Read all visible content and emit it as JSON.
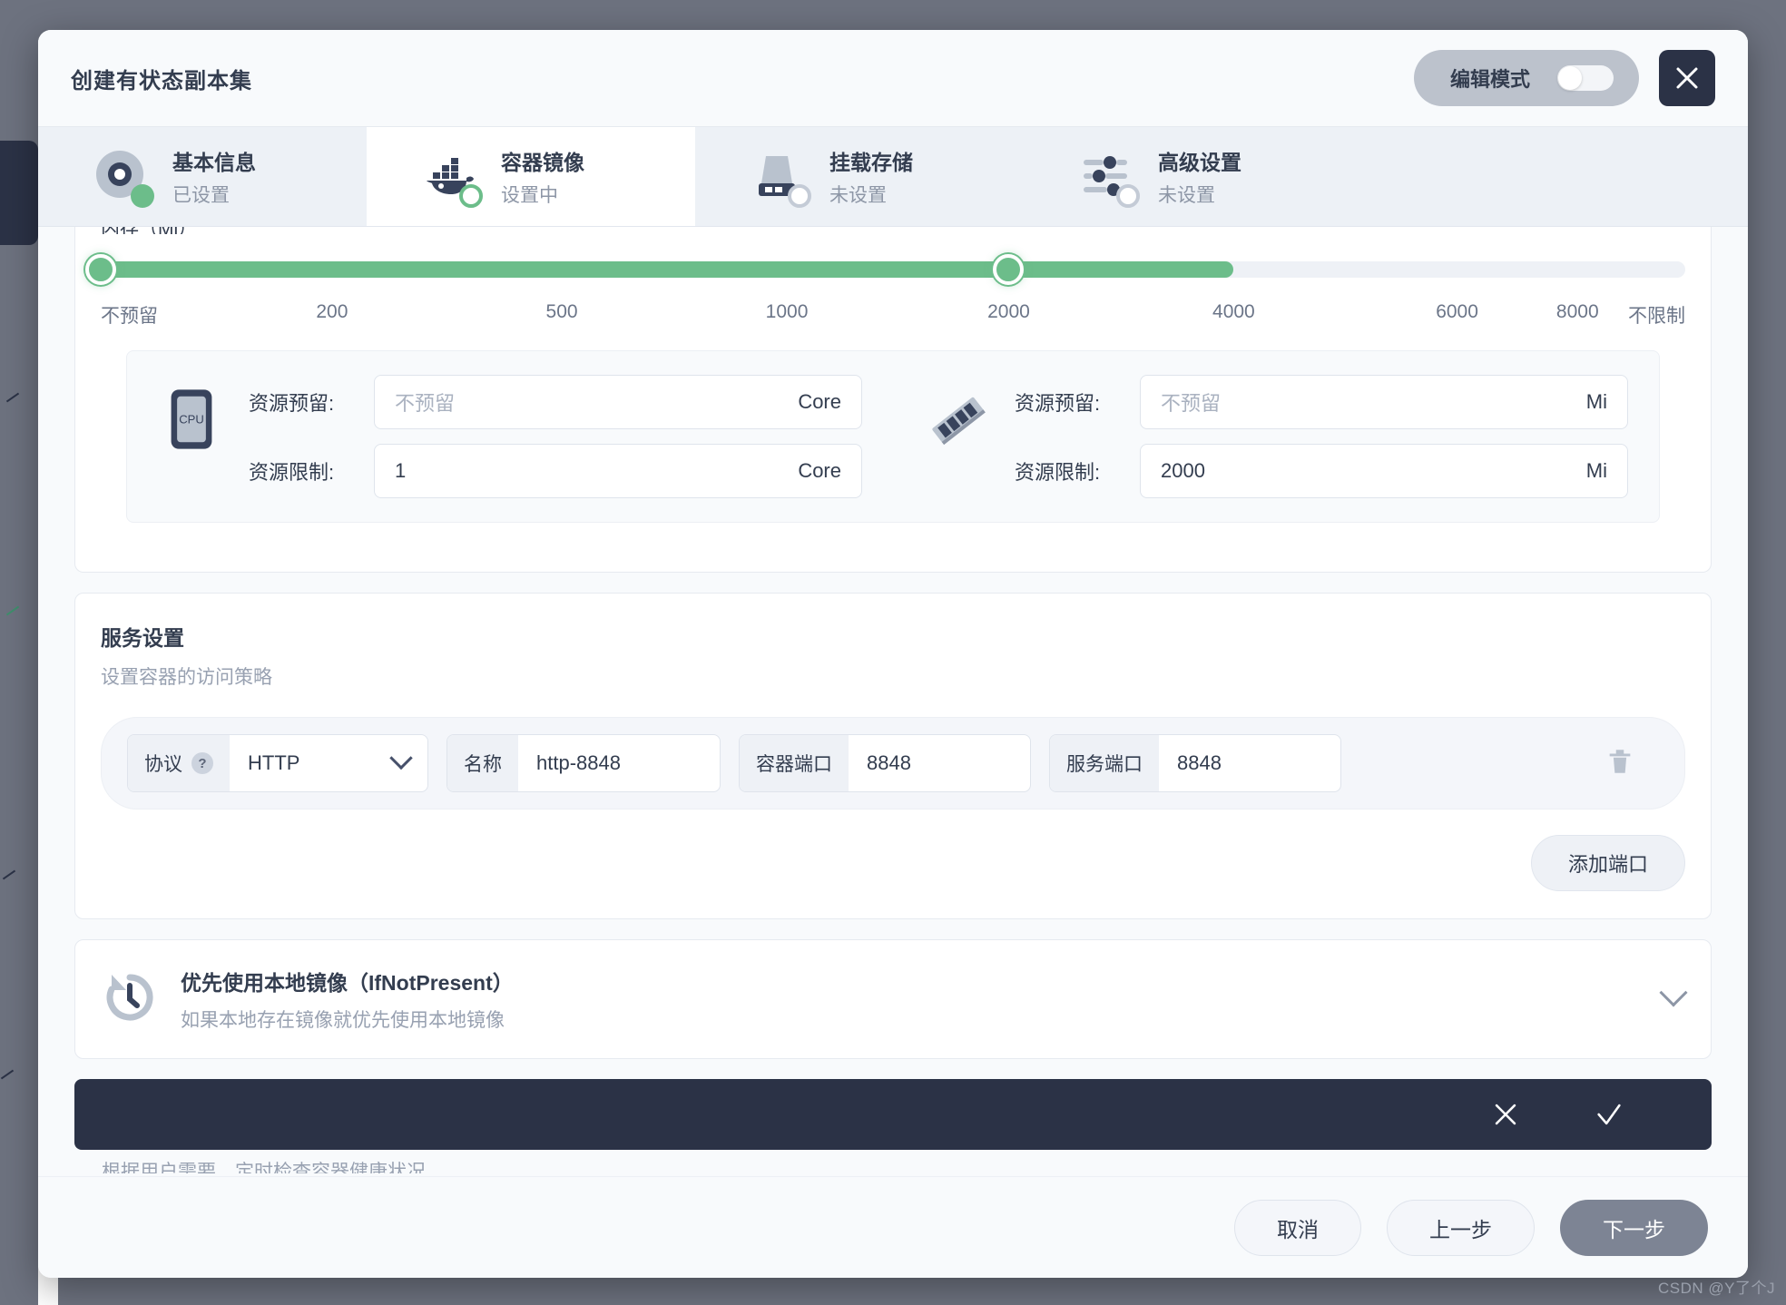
{
  "header": {
    "title": "创建有状态副本集",
    "edit_mode_label": "编辑模式",
    "edit_mode_on": false,
    "close_icon": "close-icon"
  },
  "tabs": [
    {
      "label": "基本信息",
      "status": "已设置",
      "icon": "disc-icon",
      "state": "done",
      "active": false
    },
    {
      "label": "容器镜像",
      "status": "设置中",
      "icon": "docker-icon",
      "state": "current",
      "active": true
    },
    {
      "label": "挂载存储",
      "status": "未设置",
      "icon": "storage-icon",
      "state": "todo",
      "active": false
    },
    {
      "label": "高级设置",
      "status": "未设置",
      "icon": "sliders-icon",
      "state": "todo",
      "active": false
    }
  ],
  "memory_slider": {
    "label": "内存（Mi）",
    "ticks": [
      "不预留",
      "200",
      "500",
      "1000",
      "2000",
      "4000",
      "6000",
      "8000",
      "不限制"
    ],
    "tick_positions": [
      0,
      14.6,
      29.1,
      43.3,
      57.3,
      71.5,
      85.6,
      93.2,
      100
    ],
    "start_value": "不预留",
    "end_value": "2000",
    "fill_percent": 57.3
  },
  "resources": {
    "cpu": {
      "icon": "cpu-icon",
      "request_label": "资源预留:",
      "request_value": "",
      "request_placeholder": "不预留",
      "limit_label": "资源限制:",
      "limit_value": "1",
      "unit": "Core"
    },
    "memory": {
      "icon": "memory-icon",
      "request_label": "资源预留:",
      "request_value": "",
      "request_placeholder": "不预留",
      "limit_label": "资源限制:",
      "limit_value": "2000",
      "unit": "Mi"
    }
  },
  "service": {
    "title": "服务设置",
    "subtitle": "设置容器的访问策略",
    "port_row": {
      "protocol_label": "协议",
      "protocol_help": "?",
      "protocol_value": "HTTP",
      "name_label": "名称",
      "name_value": "http-8848",
      "container_port_label": "容器端口",
      "container_port_value": "8848",
      "service_port_label": "服务端口",
      "service_port_value": "8848",
      "delete_icon": "trash-icon"
    },
    "add_port_label": "添加端口"
  },
  "pull_policy": {
    "icon": "history-icon",
    "title": "优先使用本地镜像（IfNotPresent）",
    "subtitle": "如果本地存在镜像就优先使用本地镜像",
    "expand_icon": "chevron-down-icon"
  },
  "action_bar": {
    "cancel_icon": "close-icon",
    "confirm_icon": "check-icon"
  },
  "clipped_section": {
    "text": "根据用户需要，定时检查容器健康状况"
  },
  "footer": {
    "cancel": "取消",
    "previous": "上一步",
    "next": "下一步"
  },
  "watermark": "CSDN @Y了个J",
  "colors": {
    "accent_green": "#6cbd8a",
    "dark": "#2b3246",
    "text": "#333d4f",
    "muted": "#98a1b1",
    "primary_button": "#7d8494"
  }
}
